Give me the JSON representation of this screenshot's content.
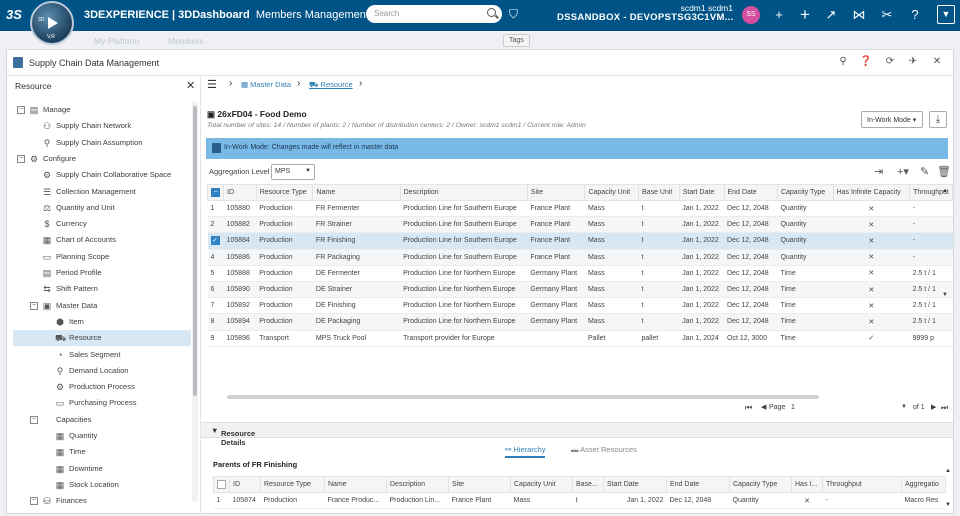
{
  "topbar": {
    "brand": "3DEXPERIENCE | 3DDashboard",
    "app": "Members Management",
    "search_placeholder": "Search",
    "tag_tooltip": "Tags",
    "user_line": "scdm1 scdm1",
    "tenant": "DSSANDBOX - DEVOPSTSG3C1VM...",
    "avatar_initials": "SS",
    "compass_labels": {
      "top": "3D",
      "left": "V,R"
    },
    "ghost_tabs": [
      "My Platform",
      "Members"
    ],
    "accent": "#005386"
  },
  "widget": {
    "title": "Supply Chain Data Management",
    "actions": [
      "search-icon",
      "help-icon",
      "refresh-icon",
      "pin-icon",
      "close-icon"
    ]
  },
  "sidebar": {
    "header": "Resource",
    "items": [
      {
        "label": "Manage",
        "indent": 0,
        "toggle": "−",
        "icon": "▤"
      },
      {
        "label": "Supply Chain Network",
        "indent": 1,
        "icon": "⚇"
      },
      {
        "label": "Supply Chain Assumption",
        "indent": 1,
        "icon": "⚲"
      },
      {
        "label": "Configure",
        "indent": 0,
        "toggle": "−",
        "icon": "⚙"
      },
      {
        "label": "Supply Chain Collaborative Space",
        "indent": 1,
        "icon": "⚙"
      },
      {
        "label": "Collection Management",
        "indent": 1,
        "icon": "☰"
      },
      {
        "label": "Quantity and Unit",
        "indent": 1,
        "icon": "⚖"
      },
      {
        "label": "Currency",
        "indent": 1,
        "icon": "$"
      },
      {
        "label": "Chart of Accounts",
        "indent": 1,
        "icon": "▦"
      },
      {
        "label": "Planning Scope",
        "indent": 1,
        "icon": "▭"
      },
      {
        "label": "Period Profile",
        "indent": 1,
        "icon": "▤"
      },
      {
        "label": "Shift Pattern",
        "indent": 1,
        "icon": "⇆"
      },
      {
        "label": "Master Data",
        "indent": 1,
        "toggle": "−",
        "icon": "▣"
      },
      {
        "label": "Item",
        "indent": 2,
        "icon": "⬢"
      },
      {
        "label": "Resource",
        "indent": 2,
        "icon": "⛟",
        "selected": true
      },
      {
        "label": "Sales Segment",
        "indent": 2,
        "icon": "◔"
      },
      {
        "label": "Demand Location",
        "indent": 2,
        "icon": "⚲"
      },
      {
        "label": "Production Process",
        "indent": 2,
        "icon": "⚙"
      },
      {
        "label": "Purchasing Process",
        "indent": 2,
        "icon": "▭"
      },
      {
        "label": "Capacities",
        "indent": 1,
        "toggle": "−",
        "icon": ""
      },
      {
        "label": "Quantity",
        "indent": 2,
        "icon": "▦"
      },
      {
        "label": "Time",
        "indent": 2,
        "icon": "▦"
      },
      {
        "label": "Downtime",
        "indent": 2,
        "icon": "▦"
      },
      {
        "label": "Stock Location",
        "indent": 2,
        "icon": "▦"
      },
      {
        "label": "Finances",
        "indent": 1,
        "toggle": "−",
        "icon": "⛁"
      }
    ]
  },
  "breadcrumb": [
    "Master Data",
    "Resource"
  ],
  "resource": {
    "title": "26xFD04 - Food Demo",
    "subtitle": "Total number of sites: 14 / Number of plants: 2 / Number of distribution centers: 2 / Owner: scdm1 scdm1 / Current role: Admin",
    "mode": "In-Work Mode",
    "banner": "In-Work Mode: Changes made will reflect in master data",
    "aggregation_label": "Aggregation Level",
    "aggregation_value": "MPS"
  },
  "grid": {
    "columns": [
      "",
      "ID",
      "Resource Type",
      "Name",
      "Description",
      "Site",
      "Capacity Unit",
      "Base Unit",
      "Start Date",
      "End Date",
      "Capacity Type",
      "Has Infinite Capacity",
      "Throughput"
    ],
    "rows": [
      {
        "n": "1",
        "id": "105880",
        "type": "Production",
        "name": "FR Fermenter",
        "desc": "Production Line for Southern Europe",
        "site": "France Plant",
        "cap": "Mass",
        "base": "t",
        "start": "Jan 1, 2022",
        "end": "Dec 12, 2048",
        "ctype": "Quantity",
        "inf": "✕",
        "thr": "-"
      },
      {
        "n": "2",
        "id": "105882",
        "type": "Production",
        "name": "FR Strainer",
        "desc": "Production Line for Southern Europe",
        "site": "France Plant",
        "cap": "Mass",
        "base": "t",
        "start": "Jan 1, 2022",
        "end": "Dec 12, 2048",
        "ctype": "Quantity",
        "inf": "✕",
        "thr": "-"
      },
      {
        "n": "3",
        "id": "105884",
        "type": "Production",
        "name": "FR Finishing",
        "desc": "Production Line for Southern Europe",
        "site": "France Plant",
        "cap": "Mass",
        "base": "t",
        "start": "Jan 1, 2022",
        "end": "Dec 12, 2048",
        "ctype": "Quantity",
        "inf": "✕",
        "thr": "-",
        "selected": true
      },
      {
        "n": "4",
        "id": "105886",
        "type": "Production",
        "name": "FR Packaging",
        "desc": "Production Line for Southern Europe",
        "site": "France Plant",
        "cap": "Mass",
        "base": "t",
        "start": "Jan 1, 2022",
        "end": "Dec 12, 2048",
        "ctype": "Quantity",
        "inf": "✕",
        "thr": "-"
      },
      {
        "n": "5",
        "id": "105888",
        "type": "Production",
        "name": "DE Fermenter",
        "desc": "Production Line for Northern Europe",
        "site": "Germany Plant",
        "cap": "Mass",
        "base": "t",
        "start": "Jan 1, 2022",
        "end": "Dec 12, 2048",
        "ctype": "Time",
        "inf": "✕",
        "thr": "2.5 t / 1"
      },
      {
        "n": "6",
        "id": "105890",
        "type": "Production",
        "name": "DE Strainer",
        "desc": "Production Line for Northern Europe",
        "site": "Germany Plant",
        "cap": "Mass",
        "base": "t",
        "start": "Jan 1, 2022",
        "end": "Dec 12, 2048",
        "ctype": "Time",
        "inf": "✕",
        "thr": "2.5 t / 1"
      },
      {
        "n": "7",
        "id": "105892",
        "type": "Production",
        "name": "DE Finishing",
        "desc": "Production Line for Northern Europe",
        "site": "Germany Plant",
        "cap": "Mass",
        "base": "t",
        "start": "Jan 1, 2022",
        "end": "Dec 12, 2048",
        "ctype": "Time",
        "inf": "✕",
        "thr": "2.5 t / 1"
      },
      {
        "n": "8",
        "id": "105894",
        "type": "Production",
        "name": "DE Packaging",
        "desc": "Production Line for Northern Europe",
        "site": "Germany Plant",
        "cap": "Mass",
        "base": "t",
        "start": "Jan 1, 2022",
        "end": "Dec 12, 2048",
        "ctype": "Time",
        "inf": "✕",
        "thr": "2.5 t / 1"
      },
      {
        "n": "9",
        "id": "105896",
        "type": "Transport",
        "name": "MPS Truck Pool",
        "desc": "Transport provider for Europe",
        "site": "",
        "cap": "Pallet",
        "base": "pallet",
        "start": "Jan 1, 2024",
        "end": "Oct 12, 3000",
        "ctype": "Time",
        "inf": "✓",
        "thr": "9999 p"
      }
    ],
    "page_label": "Page",
    "page": "1",
    "of_label": "of 1"
  },
  "details": {
    "header": "Resource Details",
    "tabs": [
      "Hierarchy",
      "Asset Resources"
    ],
    "parents_title": "Parents of FR Finishing",
    "columns": [
      "",
      "ID",
      "Resource Type",
      "Name",
      "Description",
      "Site",
      "Capacity Unit",
      "Base...",
      "Start Date",
      "End Date",
      "Capacity Type",
      "Has I...",
      "Throughput",
      "Aggregatio"
    ],
    "rows": [
      {
        "n": "1",
        "id": "105874",
        "type": "Production",
        "name": "France Produc...",
        "desc": "Production Lin...",
        "site": "France Plant",
        "cap": "Mass",
        "base": "t",
        "start": "Jan 1, 2022",
        "end": "Dec 12, 2048",
        "ctype": "Quantity",
        "inf": "✕",
        "thr": "-",
        "agg": "Macro Res"
      }
    ]
  }
}
